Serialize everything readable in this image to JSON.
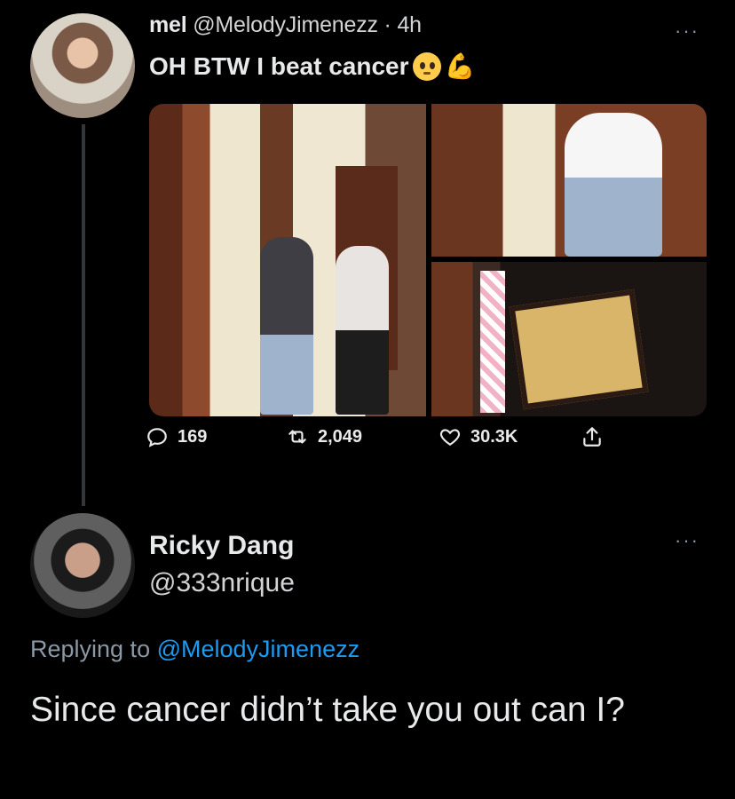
{
  "tweet": {
    "name": "mel",
    "handle": "@MelodyJimenezz",
    "separator": "·",
    "time": "4h",
    "text": "OH BTW I beat cancer",
    "emojis": [
      "pleading-face",
      "flexed-biceps"
    ],
    "actions": {
      "replies": "169",
      "retweets": "2,049",
      "likes": "30.3K"
    },
    "more": "···"
  },
  "reply": {
    "name": "Ricky Dang",
    "handle": "@333nrique",
    "more": "···",
    "replying_prefix": "Replying to",
    "replying_mention": "@MelodyJimenezz",
    "text": "Since cancer didn’t take you out can I?"
  },
  "colors": {
    "background": "#000000",
    "text": "#e7e9ea",
    "muted": "#8b98a5",
    "link": "#1d9bf0"
  }
}
